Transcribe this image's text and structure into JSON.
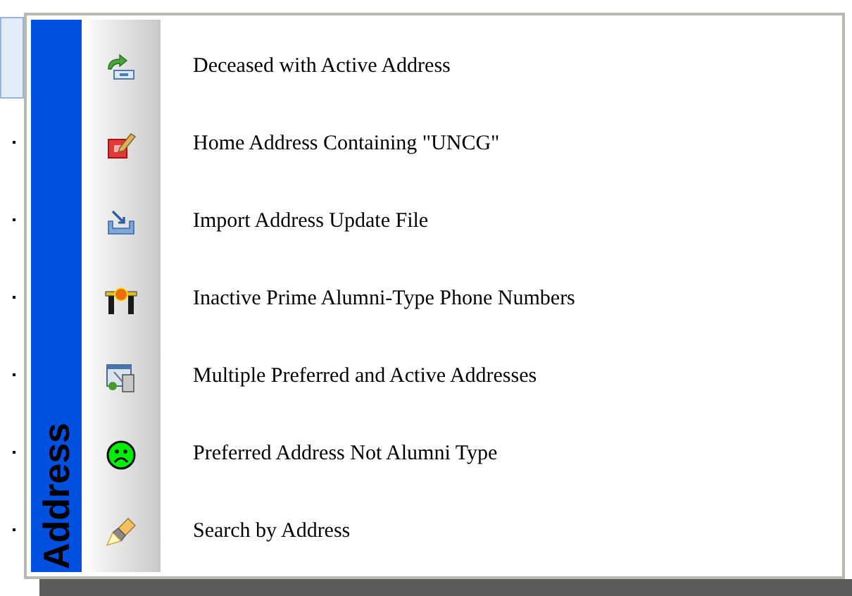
{
  "menu": {
    "title": "Address",
    "items": [
      {
        "label": "Deceased with Active Address"
      },
      {
        "label": "Home Address Containing \"UNCG\""
      },
      {
        "label": "Import Address Update File"
      },
      {
        "label": "Inactive Prime Alumni-Type Phone Numbers"
      },
      {
        "label": "Multiple Preferred and Active Addresses"
      },
      {
        "label": "Preferred Address Not Alumni Type"
      },
      {
        "label": "Search by Address"
      }
    ]
  }
}
